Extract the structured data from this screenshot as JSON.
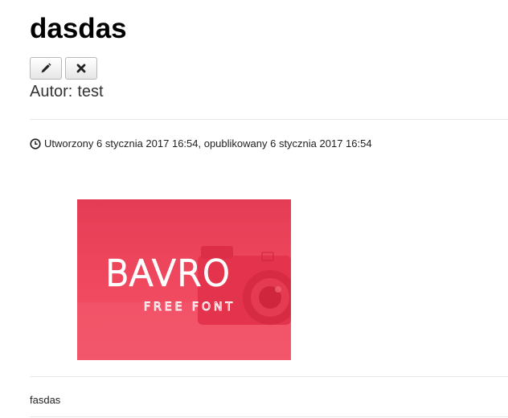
{
  "article": {
    "title": "dasdas",
    "author_label": "Autor:",
    "author_name": "test",
    "meta_text": "Utworzony 6 stycznia 2017 16:54, opublikowany 6 stycznia 2017 16:54",
    "image": {
      "logo_text": "BAVRO",
      "logo_sub": "FREE FONT",
      "background_color": "#f0495f"
    },
    "body_text": "fasdas"
  },
  "actions": {
    "edit_icon": "pencil-icon",
    "delete_icon": "close-icon"
  }
}
